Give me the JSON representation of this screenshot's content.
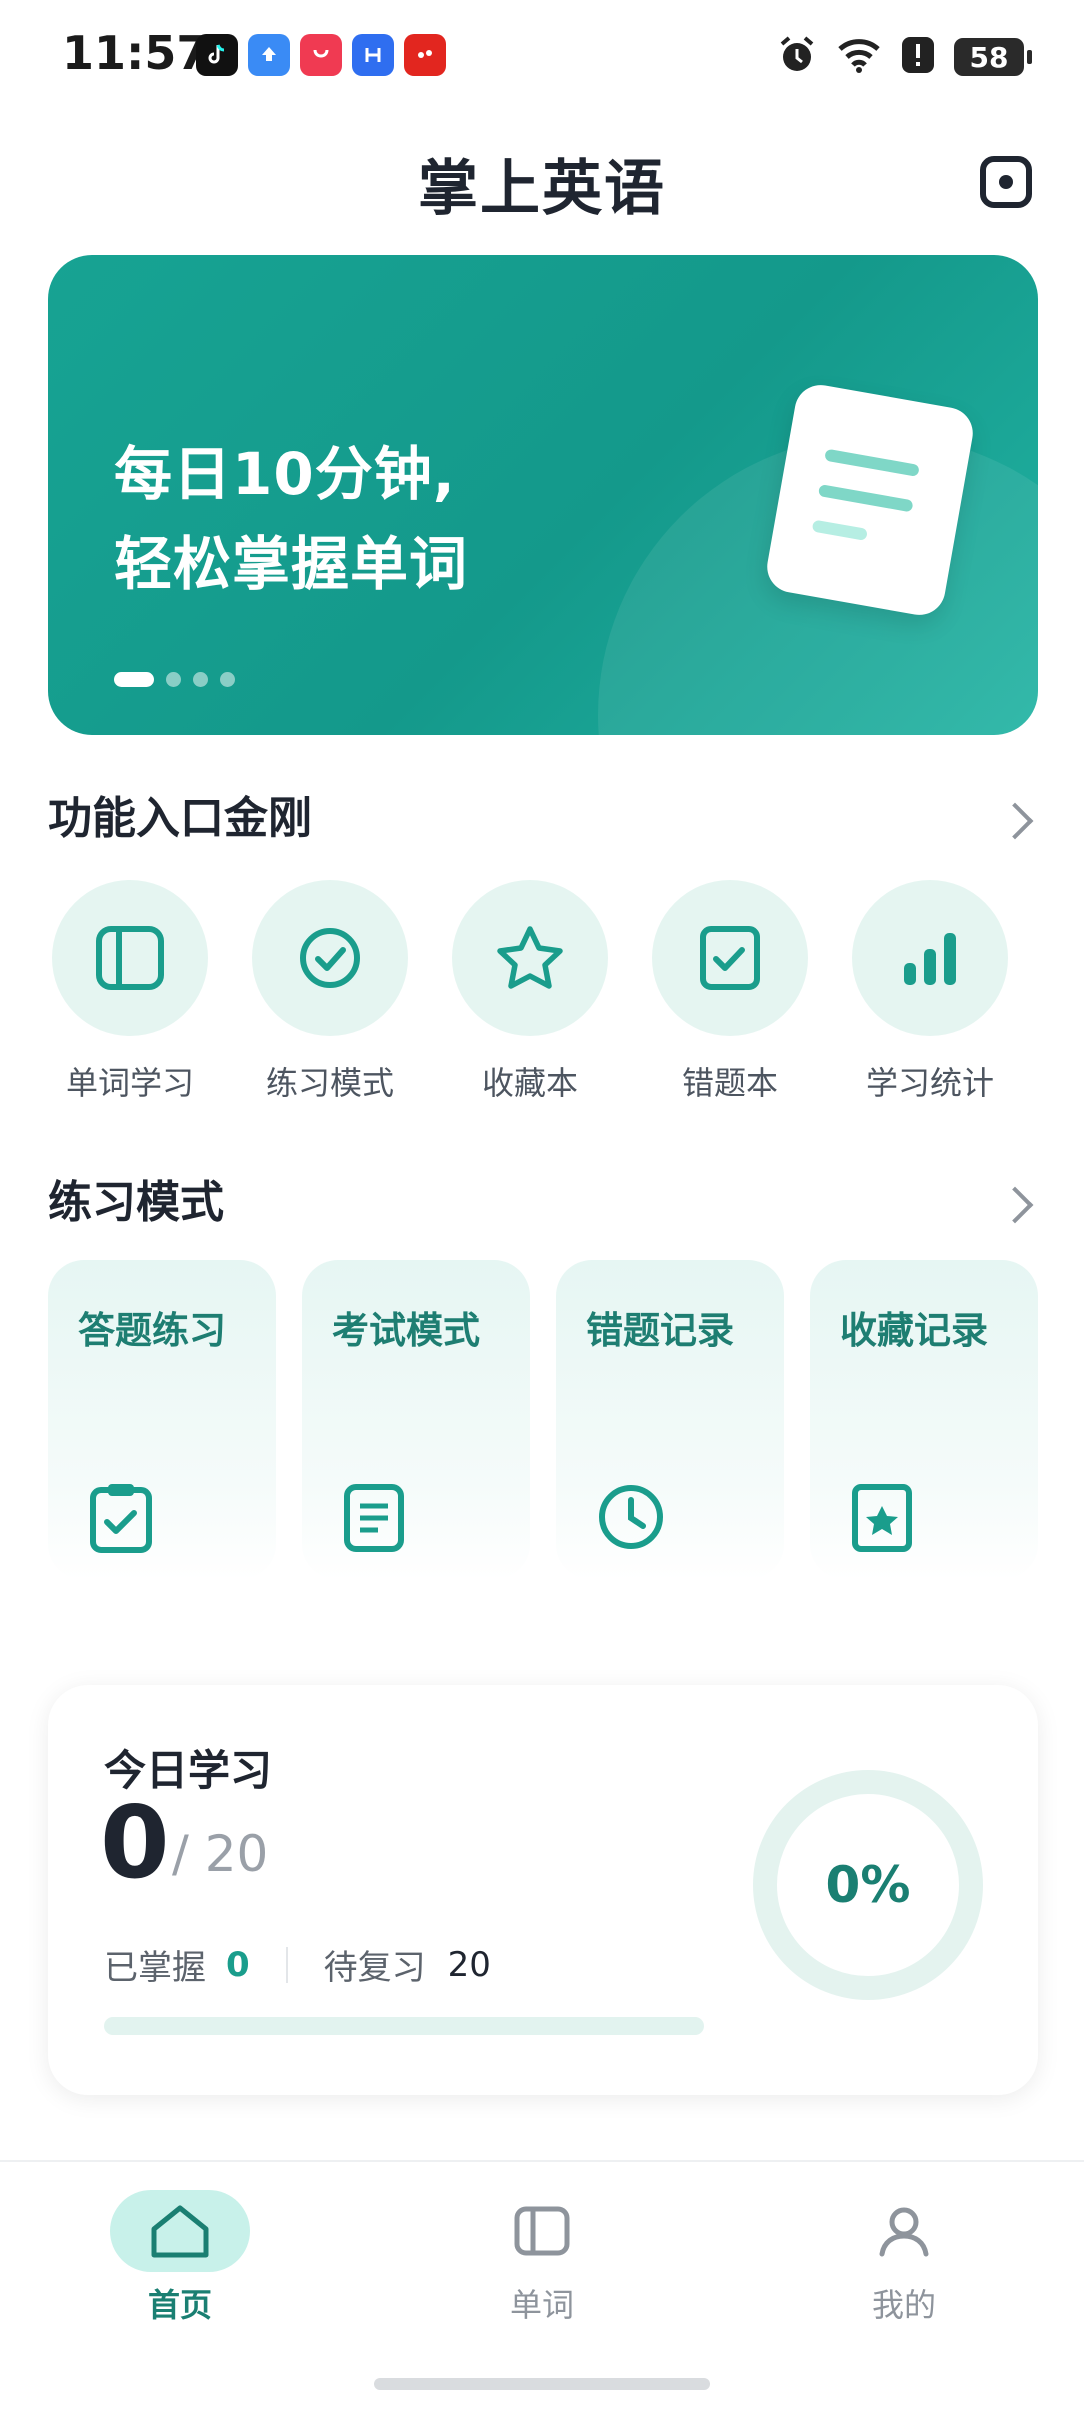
{
  "status_bar": {
    "time": "11:57",
    "battery": "58",
    "notification_icons": [
      "tiktok-icon",
      "upload-icon",
      "app-gallery-icon",
      "hn-app-icon",
      "red-app-icon"
    ],
    "system_icons": [
      "alarm-icon",
      "wifi-icon",
      "alert-icon",
      "battery-icon"
    ]
  },
  "header": {
    "title": "掌上英语",
    "right_icon": "scan-icon"
  },
  "banner": {
    "line1": "每日10分钟,",
    "line2": "轻松掌握单词",
    "slide_count": 4,
    "active_slide": 1,
    "colors": {
      "start": "#17a393",
      "end": "#22b3a3"
    }
  },
  "quick_entries": {
    "title": "功能入口金刚",
    "items": [
      {
        "label": "单词学习",
        "icon": "book-icon"
      },
      {
        "label": "练习模式",
        "icon": "check-circle-icon"
      },
      {
        "label": "收藏本",
        "icon": "star-icon"
      },
      {
        "label": "错题本",
        "icon": "check-square-icon"
      },
      {
        "label": "学习统计",
        "icon": "bar-chart-icon"
      }
    ]
  },
  "practice": {
    "title": "练习模式",
    "cards": [
      {
        "label": "答题练习",
        "icon": "clipboard-check-icon"
      },
      {
        "label": "考试模式",
        "icon": "document-icon"
      },
      {
        "label": "错题记录",
        "icon": "clock-icon"
      },
      {
        "label": "收藏记录",
        "icon": "star-card-icon"
      }
    ]
  },
  "today": {
    "title": "今日学习",
    "learned": "0",
    "total": "/ 20",
    "mastered_label": "已掌握",
    "mastered_value": "0",
    "review_label": "待复习",
    "review_value": "20",
    "progress_percent": "0%",
    "progress_fraction": 0
  },
  "bottom_nav": {
    "items": [
      {
        "label": "首页",
        "icon": "home-icon",
        "active": true
      },
      {
        "label": "单词",
        "icon": "book-icon",
        "active": false
      },
      {
        "label": "我的",
        "icon": "user-icon",
        "active": false
      }
    ]
  },
  "colors": {
    "accent": "#1a9d8c",
    "accent_dark": "#1a7f72",
    "accent_light": "#e5f5f1",
    "text_primary": "#1f2530",
    "text_secondary": "#5c636c"
  }
}
